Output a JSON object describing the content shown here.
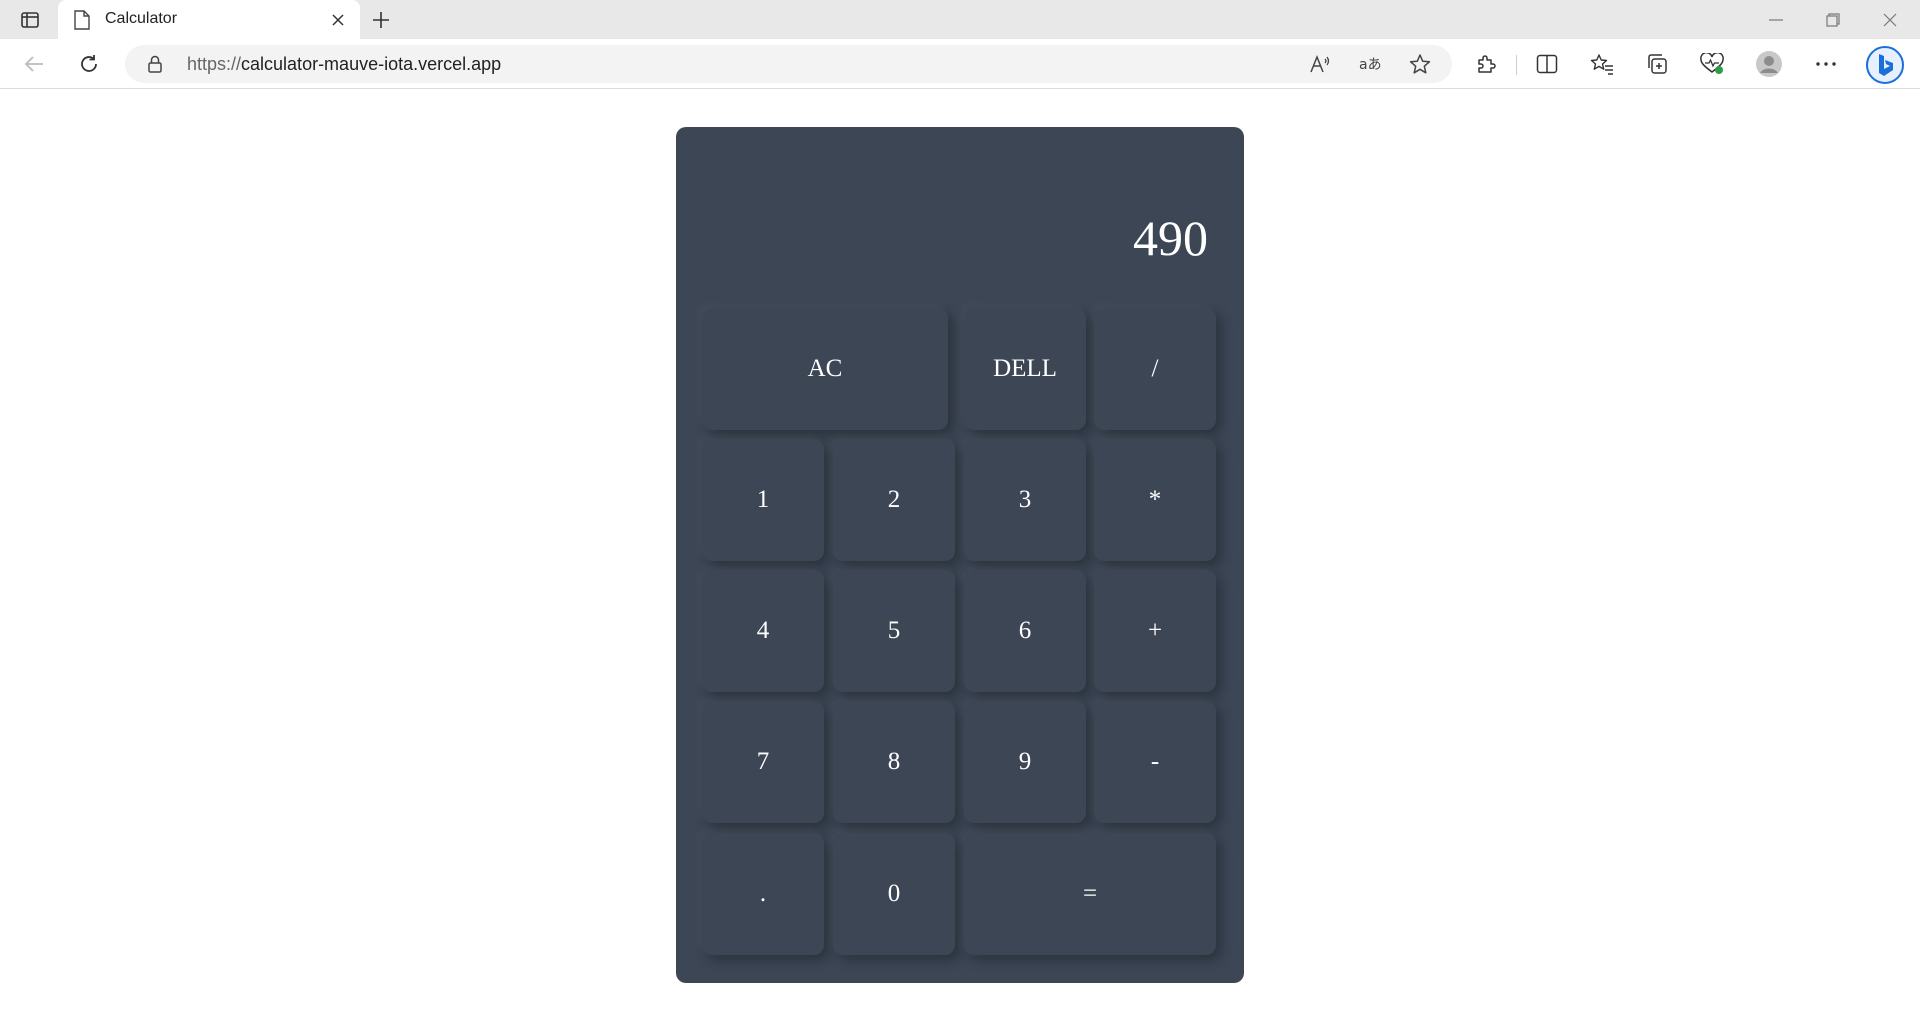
{
  "browser": {
    "tab_title": "Calculator",
    "url_protocol": "https://",
    "url_host": "calculator-mauve-iota.vercel.app"
  },
  "calculator": {
    "display": "490",
    "keys": {
      "ac": "AC",
      "del": "DELL",
      "divide": "/",
      "one": "1",
      "two": "2",
      "three": "3",
      "multiply": "*",
      "four": "4",
      "five": "5",
      "six": "6",
      "plus": "+",
      "seven": "7",
      "eight": "8",
      "nine": "9",
      "minus": "-",
      "dot": ".",
      "zero": "0",
      "equals": "="
    }
  },
  "colors": {
    "calculator_bg": "#3c4655",
    "key_text": "#ffffff",
    "page_bg": "#ffffff"
  },
  "icons": [
    "tab-actions-icon",
    "page-icon",
    "close-icon",
    "plus-icon",
    "minimize-icon",
    "restore-icon",
    "back-icon",
    "refresh-icon",
    "lock-icon",
    "read-aloud-icon",
    "translate-icon",
    "favorite-star-icon",
    "extensions-icon",
    "split-screen-icon",
    "favorites-icon",
    "collections-icon",
    "browser-essentials-icon",
    "profile-icon",
    "more-icon",
    "copilot-icon"
  ]
}
